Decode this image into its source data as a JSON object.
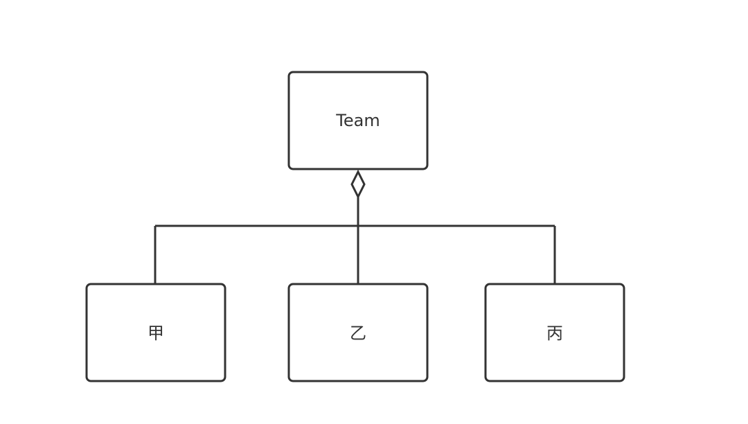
{
  "diagram": {
    "type": "uml-aggregation",
    "stroke_color": "#333333",
    "fill_color": "#ffffff",
    "root": {
      "label": "Team"
    },
    "children": [
      {
        "label": "甲"
      },
      {
        "label": "乙"
      },
      {
        "label": "丙"
      }
    ],
    "relationship": "aggregation"
  }
}
